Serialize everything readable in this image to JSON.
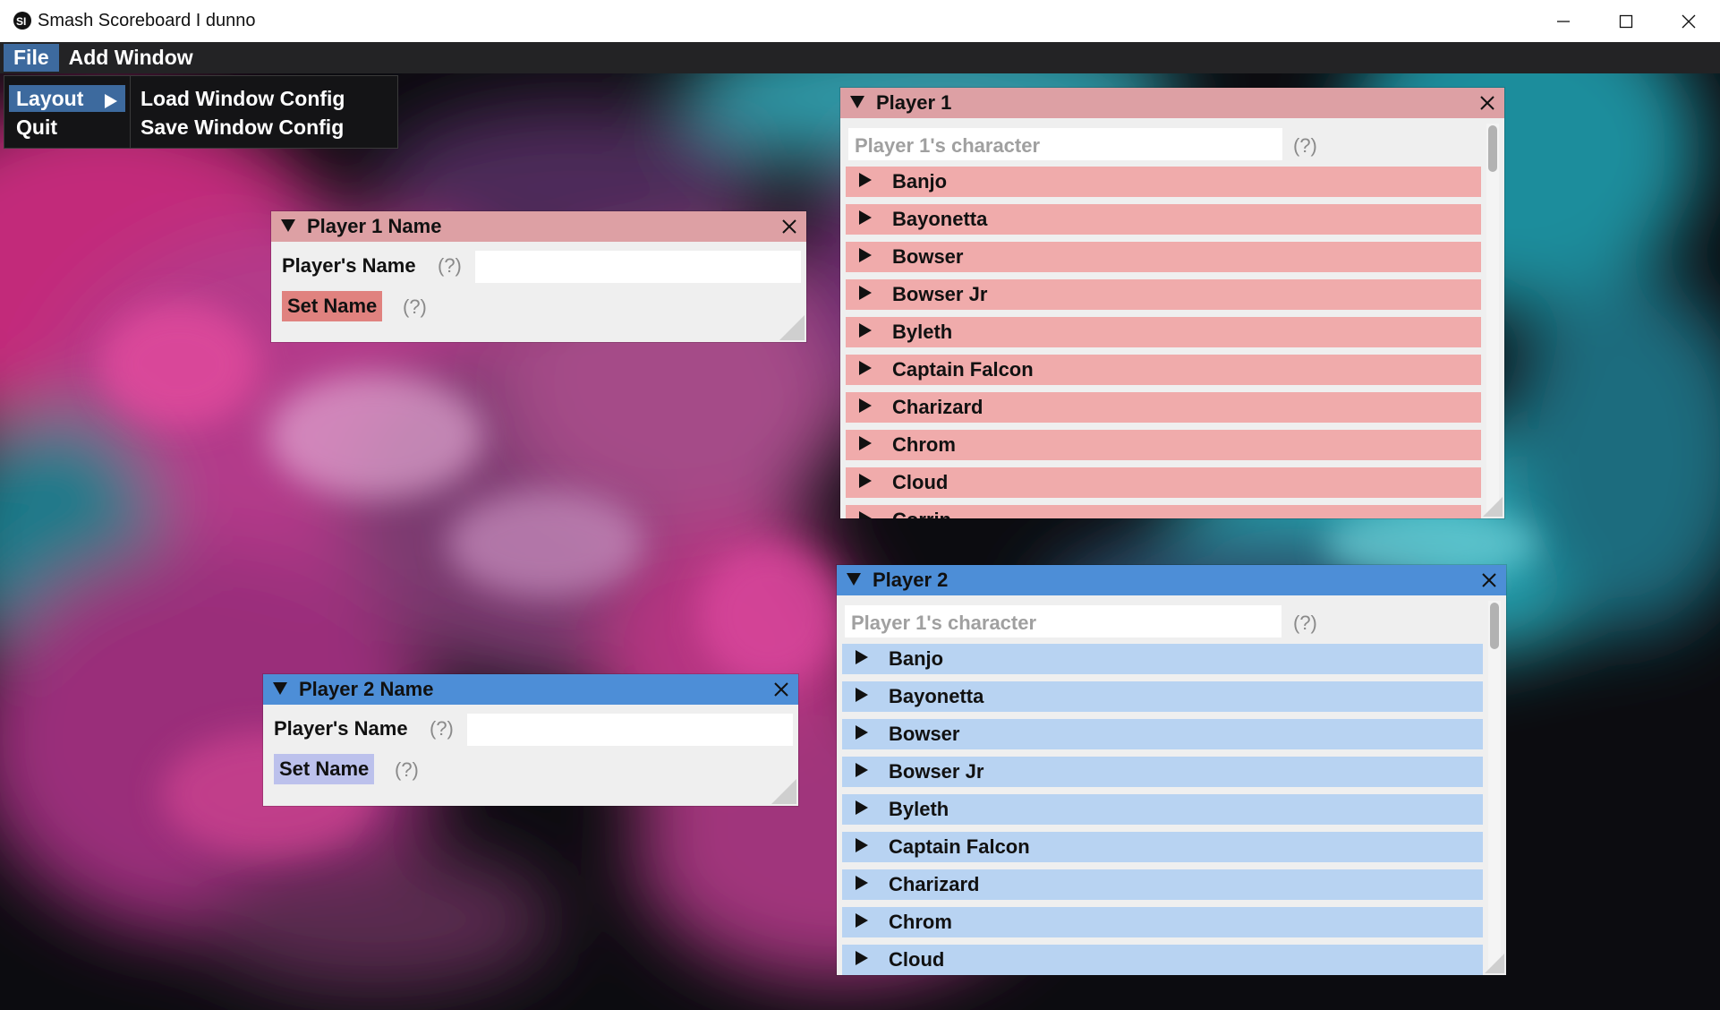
{
  "window": {
    "title": "Smash Scoreboard I dunno",
    "app_icon": "app-icon",
    "controls": [
      "minimize-icon",
      "maximize-icon",
      "close-icon"
    ]
  },
  "menubar": {
    "items": [
      {
        "label": "File",
        "active": true
      },
      {
        "label": "Add Window",
        "active": false
      }
    ]
  },
  "file_menu": {
    "items": [
      {
        "label": "Layout",
        "has_submenu": true,
        "selected": true
      },
      {
        "label": "Quit"
      }
    ]
  },
  "layout_submenu": {
    "items": [
      {
        "label": "Load Window Config"
      },
      {
        "label": "Save Window Config"
      }
    ]
  },
  "player1_name_window": {
    "title": "Player 1 Name",
    "name_label": "Player's Name",
    "name_help": "(?)",
    "name_value": "",
    "set_button": "Set Name",
    "set_help": "(?)"
  },
  "player2_name_window": {
    "title": "Player 2 Name",
    "name_label": "Player's Name",
    "name_help": "(?)",
    "name_value": "",
    "set_button": "Set Name",
    "set_help": "(?)"
  },
  "player1_window": {
    "title": "Player 1",
    "search_placeholder": "Player 1's character",
    "search_help": "(?)",
    "characters": [
      "Banjo",
      "Bayonetta",
      "Bowser",
      "Bowser Jr",
      "Byleth",
      "Captain Falcon",
      "Charizard",
      "Chrom",
      "Cloud",
      "Corrin"
    ]
  },
  "player2_window": {
    "title": "Player 2",
    "search_placeholder": "Player 1's character",
    "search_help": "(?)",
    "characters": [
      "Banjo",
      "Bayonetta",
      "Bowser",
      "Bowser Jr",
      "Byleth",
      "Captain Falcon",
      "Charizard",
      "Chrom",
      "Cloud"
    ]
  },
  "colors": {
    "menubar_bg": "#232325",
    "menu_highlight": "#3d6a9e",
    "p1_title": "#dda0a4",
    "p1_row": "#f0abab",
    "p1_button": "#e0827f",
    "p2_title": "#4d8ed7",
    "p2_row": "#b8d3f2",
    "p2_button": "#bcc1ec",
    "window_bg": "#efefef"
  }
}
